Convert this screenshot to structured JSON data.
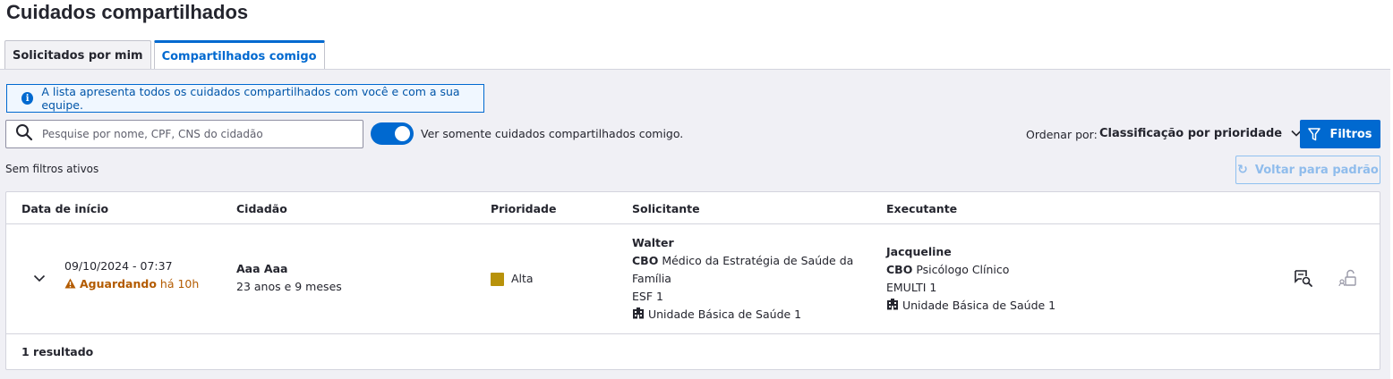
{
  "page": {
    "title": "Cuidados compartilhados"
  },
  "tabs": [
    {
      "label": "Solicitados por mim",
      "active": false
    },
    {
      "label": "Compartilhados comigo",
      "active": true
    }
  ],
  "banner": {
    "icon": "info-icon",
    "text": "A lista apresenta todos os cuidados compartilhados com você e com a sua equipe."
  },
  "search": {
    "placeholder": "Pesquise por nome, CPF, CNS do cidadão",
    "value": ""
  },
  "toggle": {
    "label": "Ver somente cuidados compartilhados comigo.",
    "on": true
  },
  "sort": {
    "label": "Ordenar por:",
    "value": "Classificação por prioridade"
  },
  "buttons": {
    "filters": "Filtros",
    "reset": "Voltar para padrão"
  },
  "filters_status": "Sem filtros ativos",
  "table": {
    "headers": [
      "Data de início",
      "Cidadão",
      "Prioridade",
      "Solicitante",
      "Executante"
    ],
    "rows": [
      {
        "date": "09/10/2024 - 07:37",
        "status": "Aguardando",
        "elapsed": "há 10h",
        "citizen_name": "Aaa Aaa",
        "citizen_age": "23 anos e 9 meses",
        "priority": "Alta",
        "requester": {
          "name": "Walter",
          "cbo_label": "CBO",
          "cbo_line1": "Médico da Estratégia de Saúde da",
          "cbo_line2": "Família",
          "team": "ESF 1",
          "unit": "Unidade Básica de Saúde 1"
        },
        "executor": {
          "name": "Jacqueline",
          "cbo_label": "CBO",
          "cbo": "Psicólogo Clínico",
          "team": "EMULTI 1",
          "unit": "Unidade Básica de Saúde 1"
        }
      }
    ],
    "result_count": "1 resultado"
  },
  "colors": {
    "primary": "#0069d0",
    "warning": "#b35b00",
    "priority_high": "#b8920a"
  }
}
